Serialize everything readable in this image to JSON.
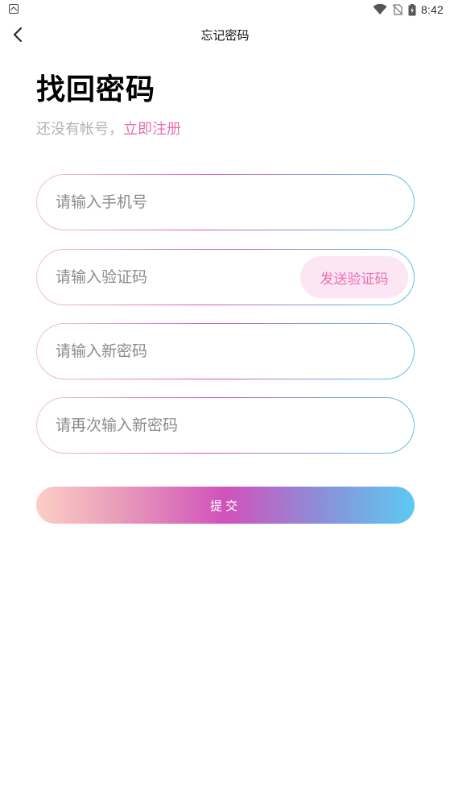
{
  "status_bar": {
    "time": "8:42",
    "icons": [
      "app-notification-icon",
      "wifi-icon",
      "no-sim-icon",
      "battery-charging-icon"
    ]
  },
  "nav": {
    "title": "忘记密码",
    "back_icon": "chevron-left-icon"
  },
  "heading": {
    "title": "找回密码",
    "prompt": "还没有帐号，",
    "register_link": "立即注册"
  },
  "form": {
    "phone_placeholder": "请输入手机号",
    "code_placeholder": "请输入验证码",
    "send_code_label": "发送验证码",
    "new_password_placeholder": "请输入新密码",
    "confirm_password_placeholder": "请再次输入新密码",
    "submit_label": "提交"
  },
  "colors": {
    "accent_pink": "#e56fb6",
    "send_code_bg": "#fde6f3",
    "gradient_start": "#fccfc3",
    "gradient_mid": "#d152ba",
    "gradient_end": "#5ccaf2"
  }
}
